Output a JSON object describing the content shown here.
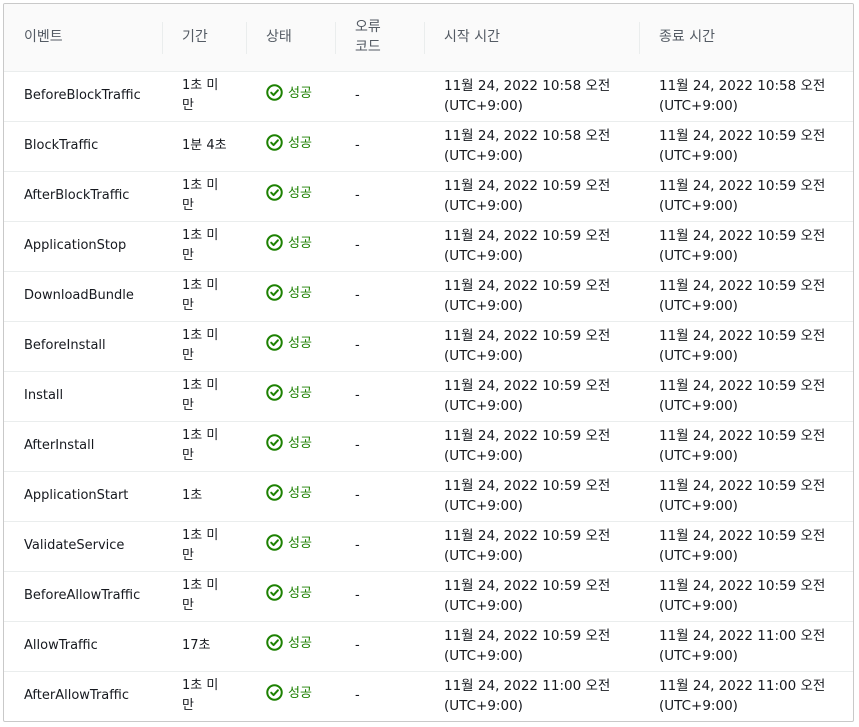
{
  "headers": {
    "event": "이벤트",
    "duration": "기간",
    "status": "상태",
    "error_code_line1": "오류",
    "error_code_line2": "코드",
    "start_time": "시작 시간",
    "end_time": "종료 시간"
  },
  "status_icon": "check-circle-icon",
  "success_color": "#1d8102",
  "rows": [
    {
      "event": "BeforeBlockTraffic",
      "duration": "1초 미만",
      "status": "성공",
      "error_code": "-",
      "start_date": "11월 24, 2022 10:58 오전",
      "start_tz": "(UTC+9:00)",
      "end_date": "11월 24, 2022 10:58 오전",
      "end_tz": "(UTC+9:00)"
    },
    {
      "event": "BlockTraffic",
      "duration": "1분 4초",
      "status": "성공",
      "error_code": "-",
      "start_date": "11월 24, 2022 10:58 오전",
      "start_tz": "(UTC+9:00)",
      "end_date": "11월 24, 2022 10:59 오전",
      "end_tz": "(UTC+9:00)"
    },
    {
      "event": "AfterBlockTraffic",
      "duration": "1초 미만",
      "status": "성공",
      "error_code": "-",
      "start_date": "11월 24, 2022 10:59 오전",
      "start_tz": "(UTC+9:00)",
      "end_date": "11월 24, 2022 10:59 오전",
      "end_tz": "(UTC+9:00)"
    },
    {
      "event": "ApplicationStop",
      "duration": "1초 미만",
      "status": "성공",
      "error_code": "-",
      "start_date": "11월 24, 2022 10:59 오전",
      "start_tz": "(UTC+9:00)",
      "end_date": "11월 24, 2022 10:59 오전",
      "end_tz": "(UTC+9:00)"
    },
    {
      "event": "DownloadBundle",
      "duration": "1초 미만",
      "status": "성공",
      "error_code": "-",
      "start_date": "11월 24, 2022 10:59 오전",
      "start_tz": "(UTC+9:00)",
      "end_date": "11월 24, 2022 10:59 오전",
      "end_tz": "(UTC+9:00)"
    },
    {
      "event": "BeforeInstall",
      "duration": "1초 미만",
      "status": "성공",
      "error_code": "-",
      "start_date": "11월 24, 2022 10:59 오전",
      "start_tz": "(UTC+9:00)",
      "end_date": "11월 24, 2022 10:59 오전",
      "end_tz": "(UTC+9:00)"
    },
    {
      "event": "Install",
      "duration": "1초 미만",
      "status": "성공",
      "error_code": "-",
      "start_date": "11월 24, 2022 10:59 오전",
      "start_tz": "(UTC+9:00)",
      "end_date": "11월 24, 2022 10:59 오전",
      "end_tz": "(UTC+9:00)"
    },
    {
      "event": "AfterInstall",
      "duration": "1초 미만",
      "status": "성공",
      "error_code": "-",
      "start_date": "11월 24, 2022 10:59 오전",
      "start_tz": "(UTC+9:00)",
      "end_date": "11월 24, 2022 10:59 오전",
      "end_tz": "(UTC+9:00)"
    },
    {
      "event": "ApplicationStart",
      "duration": "1초",
      "status": "성공",
      "error_code": "-",
      "start_date": "11월 24, 2022 10:59 오전",
      "start_tz": "(UTC+9:00)",
      "end_date": "11월 24, 2022 10:59 오전",
      "end_tz": "(UTC+9:00)"
    },
    {
      "event": "ValidateService",
      "duration": "1초 미만",
      "status": "성공",
      "error_code": "-",
      "start_date": "11월 24, 2022 10:59 오전",
      "start_tz": "(UTC+9:00)",
      "end_date": "11월 24, 2022 10:59 오전",
      "end_tz": "(UTC+9:00)"
    },
    {
      "event": "BeforeAllowTraffic",
      "duration": "1초 미만",
      "status": "성공",
      "error_code": "-",
      "start_date": "11월 24, 2022 10:59 오전",
      "start_tz": "(UTC+9:00)",
      "end_date": "11월 24, 2022 10:59 오전",
      "end_tz": "(UTC+9:00)"
    },
    {
      "event": "AllowTraffic",
      "duration": "17초",
      "status": "성공",
      "error_code": "-",
      "start_date": "11월 24, 2022 10:59 오전",
      "start_tz": "(UTC+9:00)",
      "end_date": "11월 24, 2022 11:00 오전",
      "end_tz": "(UTC+9:00)"
    },
    {
      "event": "AfterAllowTraffic",
      "duration": "1초 미만",
      "status": "성공",
      "error_code": "-",
      "start_date": "11월 24, 2022 11:00 오전",
      "start_tz": "(UTC+9:00)",
      "end_date": "11월 24, 2022 11:00 오전",
      "end_tz": "(UTC+9:00)"
    }
  ]
}
